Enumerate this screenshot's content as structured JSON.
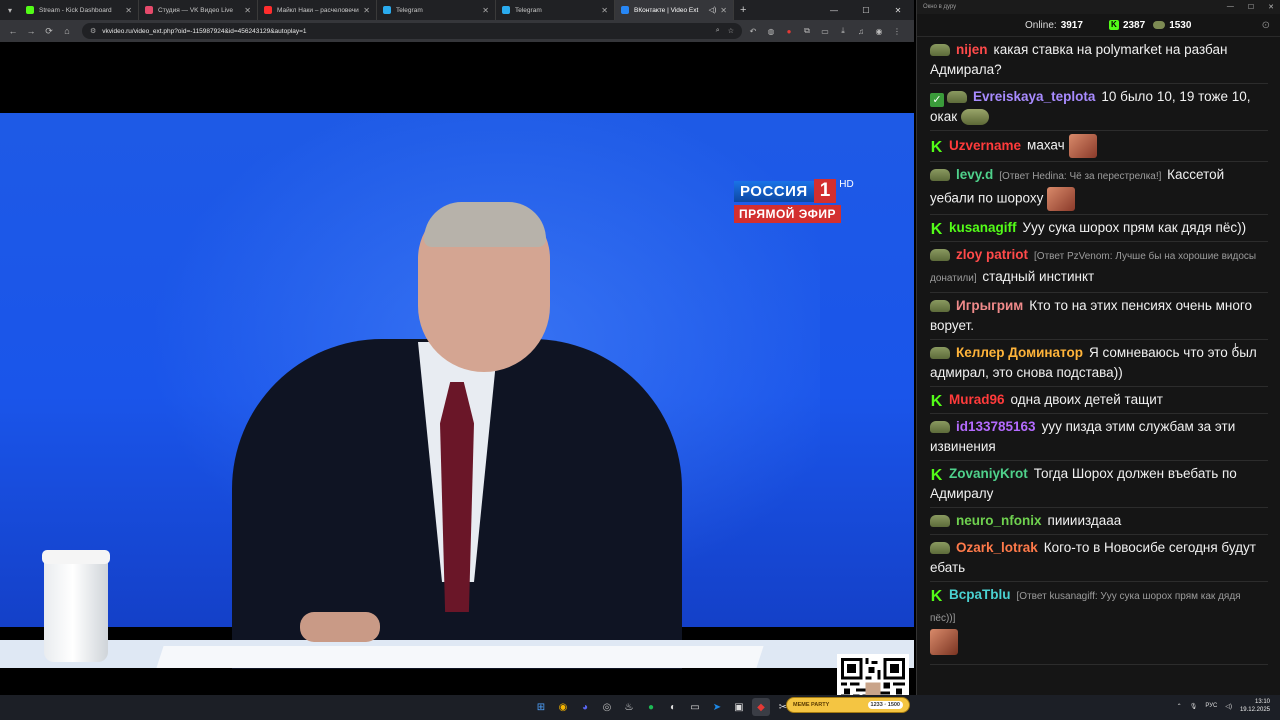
{
  "browser": {
    "tabs": [
      {
        "label": "Stream - Kick Dashboard",
        "fav": "#53fc18",
        "active": false
      },
      {
        "label": "Студия — VK Видео Live",
        "fav": "#e64a6b",
        "active": false
      },
      {
        "label": "Майкл Наки – расчеловечивание",
        "fav": "#ff2d2d",
        "active": false
      },
      {
        "label": "Telegram",
        "fav": "#2aabee",
        "active": false
      },
      {
        "label": "Telegram",
        "fav": "#2aabee",
        "active": false
      },
      {
        "label": "ВКонтакте | Video Ext",
        "fav": "#2787f5",
        "active": true
      }
    ],
    "url": "vkvideo.ru/video_ext.php?oid=-115987924&id=456243129&autoplay=1"
  },
  "video": {
    "channel_name": "РОССИЯ",
    "channel_number": "1",
    "hd_label": "HD",
    "live_label": "ПРЯМОЙ ЭФИР"
  },
  "chat": {
    "window_title": "Окно в дуру",
    "online_label": "Online:",
    "online_count": "3917",
    "kick_count": "2387",
    "pepe_count": "1530",
    "messages": [
      {
        "user": "nijen",
        "color": "#ff4a4a",
        "badge": "p",
        "reply": "",
        "text": "какая ставка на polymarket на разбан Адмирала?"
      },
      {
        "user": "Evreiskaya_teplota",
        "color": "#a88bff",
        "badge": "check",
        "reply": "",
        "text": "10 было 10, 19 тоже 10, окак"
      },
      {
        "user": "Uzvername",
        "color": "#ff3b3b",
        "badge": "k",
        "reply": "",
        "text": "махач"
      },
      {
        "user": "levy.d",
        "color": "#4fd18b",
        "badge": "p",
        "reply": "[Ответ Hedina: Чё за перестрелка!]",
        "text": "Кассетой уебали по шороху"
      },
      {
        "user": "kusanagiff",
        "color": "#53fc18",
        "badge": "k",
        "reply": "",
        "text": "Ууу сука шорох прям как дядя пёс))"
      },
      {
        "user": "zloy patriot",
        "color": "#ff4a4a",
        "badge": "p",
        "reply": "[Ответ PzVenom: Лучше бы на хорошие видосы донатили]",
        "text": "стадный инстинкт"
      },
      {
        "user": "Игрыгрим",
        "color": "#f08a8a",
        "badge": "p",
        "reply": "",
        "text": "Кто то на этих пенсиях очень много ворует."
      },
      {
        "user": "Келлер Доминатор",
        "color": "#ffb43a",
        "badge": "p",
        "reply": "",
        "text": "Я сомневаюсь что это был адмирал, это снова подстава))"
      },
      {
        "user": "Murad96",
        "color": "#ff3b3b",
        "badge": "k",
        "reply": "",
        "text": "одна двоих детей тащит"
      },
      {
        "user": "id133785163",
        "color": "#b46bff",
        "badge": "p",
        "reply": "",
        "text": "ууу пизда этим службам за эти извинения"
      },
      {
        "user": "ZovaniyKrot",
        "color": "#4fd18b",
        "badge": "k",
        "reply": "",
        "text": "Тогда Шорох должен въебать по Адмиралу"
      },
      {
        "user": "neuro_nfonix",
        "color": "#6fd14f",
        "badge": "p",
        "reply": "",
        "text": "пииииздааа"
      },
      {
        "user": "Ozark_lotrak",
        "color": "#ff7a4a",
        "badge": "p",
        "reply": "",
        "text": "Кого-то в Новосибе сегодня будут ебать"
      },
      {
        "user": "ВcpaTblu",
        "color": "#4ad1d1",
        "badge": "k",
        "reply": "[Ответ kusanagiff: Ууу сука шорох прям как дядя пёс))]",
        "text": ""
      }
    ]
  },
  "taskbar": {
    "meme_label": "MEME PARTY",
    "meme_stats": "1233 ◦ 1500",
    "lang": "РУС",
    "time": "13:10",
    "date": "19.12.2025"
  }
}
